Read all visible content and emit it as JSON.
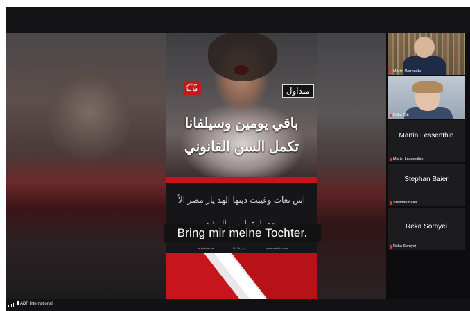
{
  "main_video": {
    "logo_line1": "مباشر",
    "logo_line2": "قنا نجا",
    "trending_badge": "متداول",
    "headline_line1": "باقي يومين وسيلفانا",
    "headline_line2": "تكمل السن القانوني",
    "panel_line1": "اس تغاث وغيبت دينها الهد يار مصر الأ",
    "panel_line2": "بعد بلوغها سن الرشد",
    "panel_footer_left": "mubasher.net",
    "panel_footer_mid": "مباشر قنا نجا",
    "panel_footer_right": "www.elmihni.com",
    "subtitle": "Bring mir meine Tochter."
  },
  "participants": [
    {
      "name": "Martin Warnecke",
      "video": true
    },
    {
      "name": "Erika Gitt",
      "video": true
    },
    {
      "name": "Martin Lessenthin",
      "video": false
    },
    {
      "name": "Stephan Baier",
      "video": false
    },
    {
      "name": "Reka Sornyei",
      "video": false
    }
  ],
  "bottom_bar": {
    "presenter_name": "ADF International"
  },
  "colors": {
    "accent_red": "#c8151c",
    "mic_muted": "#e03a3a",
    "background": "#0d0d0f"
  },
  "icons": {
    "signal": "signal-bars-icon",
    "mic": "mic-muted-icon"
  }
}
